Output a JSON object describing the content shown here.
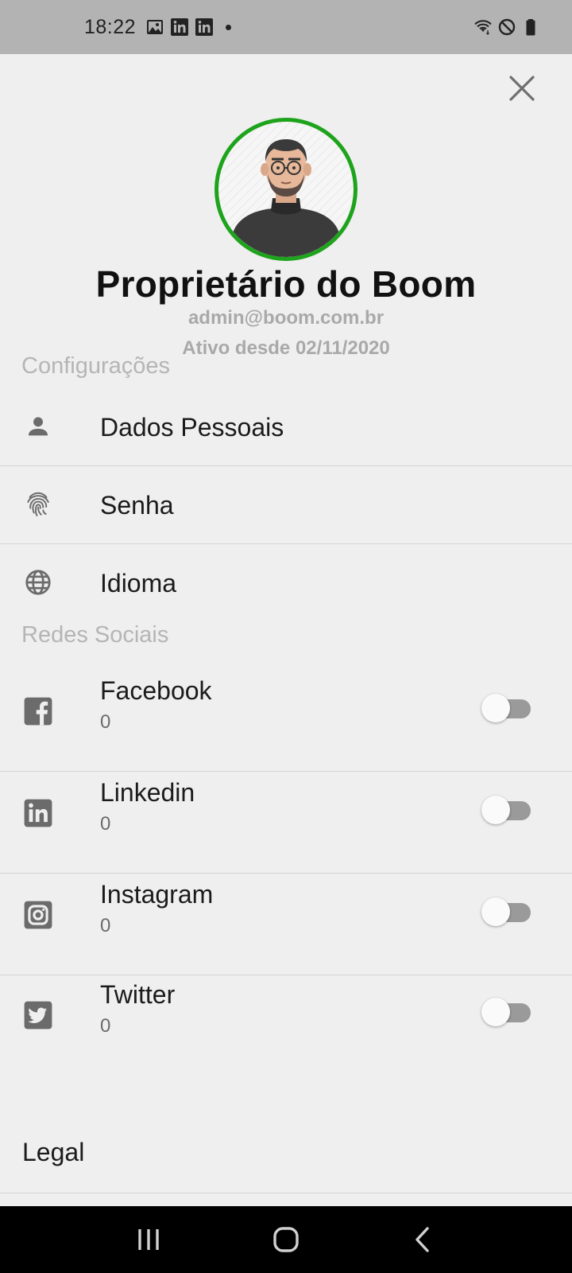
{
  "status_bar": {
    "time": "18:22",
    "left_icons": [
      "image-notification-icon",
      "linkedin-notification-icon",
      "linkedin-notification-icon",
      "dot-icon"
    ],
    "right_icons": [
      "wifi-icon",
      "do-not-disturb-icon",
      "battery-icon"
    ]
  },
  "profile": {
    "name": "Proprietário do Boom",
    "email": "admin@boom.com.br",
    "since": "Ativo desde 02/11/2020",
    "ring_color": "#1ea31c"
  },
  "settings": {
    "title": "Configurações",
    "items": [
      {
        "label": "Dados Pessoais",
        "icon": "person-icon"
      },
      {
        "label": "Senha",
        "icon": "fingerprint-icon"
      },
      {
        "label": "Idioma",
        "icon": "globe-icon"
      }
    ]
  },
  "social": {
    "title": "Redes Sociais",
    "items": [
      {
        "label": "Facebook",
        "count": "0",
        "icon": "facebook-icon",
        "enabled": false
      },
      {
        "label": "Linkedin",
        "count": "0",
        "icon": "linkedin-icon",
        "enabled": false
      },
      {
        "label": "Instagram",
        "count": "0",
        "icon": "instagram-icon",
        "enabled": false
      },
      {
        "label": "Twitter",
        "count": "0",
        "icon": "twitter-icon",
        "enabled": false
      }
    ]
  },
  "legal": {
    "label": "Legal"
  },
  "nav": {
    "buttons": [
      "recent-apps-icon",
      "home-icon",
      "back-icon"
    ]
  }
}
